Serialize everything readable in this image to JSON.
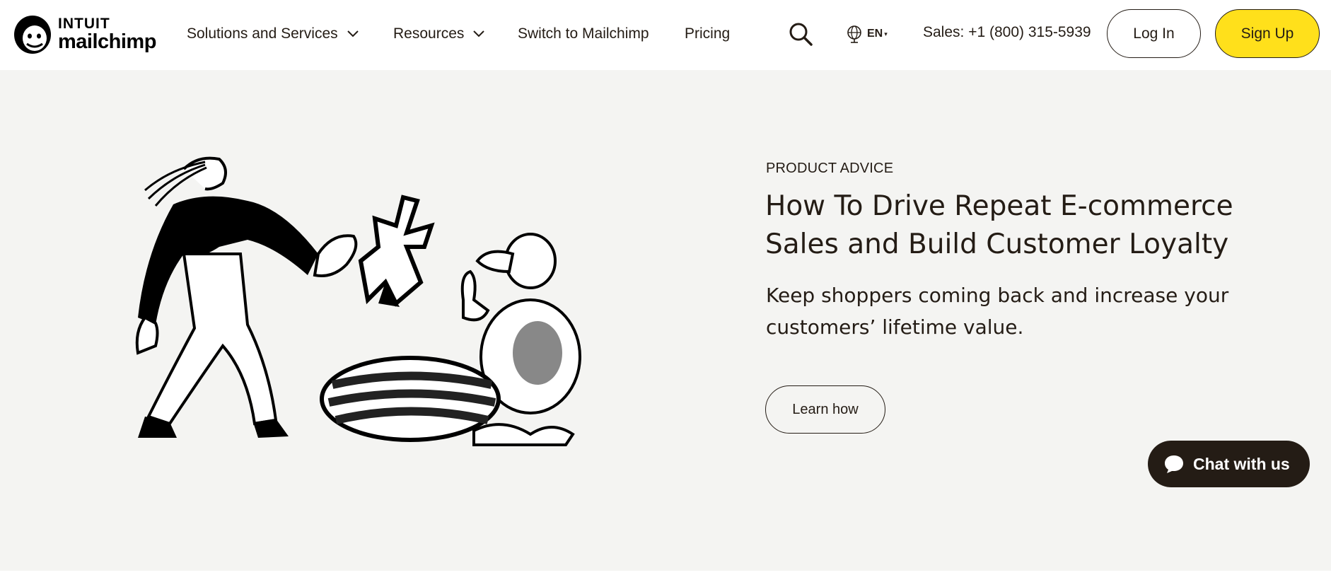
{
  "header": {
    "logo": {
      "top_line": "INTUIT",
      "bottom_line": "mailchimp"
    },
    "nav": [
      {
        "label": "Solutions and Services",
        "has_dropdown": true
      },
      {
        "label": "Resources",
        "has_dropdown": true
      },
      {
        "label": "Switch to Mailchimp",
        "has_dropdown": false
      },
      {
        "label": "Pricing",
        "has_dropdown": false
      }
    ],
    "search_icon": "search-icon",
    "language": {
      "icon": "globe-icon",
      "label": "EN"
    },
    "sales": "Sales: +1 (800) 315-5939",
    "login_label": "Log In",
    "signup_label": "Sign Up"
  },
  "hero": {
    "illustration_icon": "hero-illustration",
    "eyebrow": "PRODUCT ADVICE",
    "headline": "How To Drive Repeat E-commerce Sales and Build Customer Loyalty",
    "subtext": "Keep shoppers coming back and increase your customers’ lifetime value.",
    "cta_label": "Learn how"
  },
  "chat": {
    "icon": "chat-bubble-icon",
    "label": "Chat with us"
  },
  "colors": {
    "brand_yellow": "#ffe01b",
    "ink": "#241c15",
    "hero_bg": "#f4f4f2"
  }
}
